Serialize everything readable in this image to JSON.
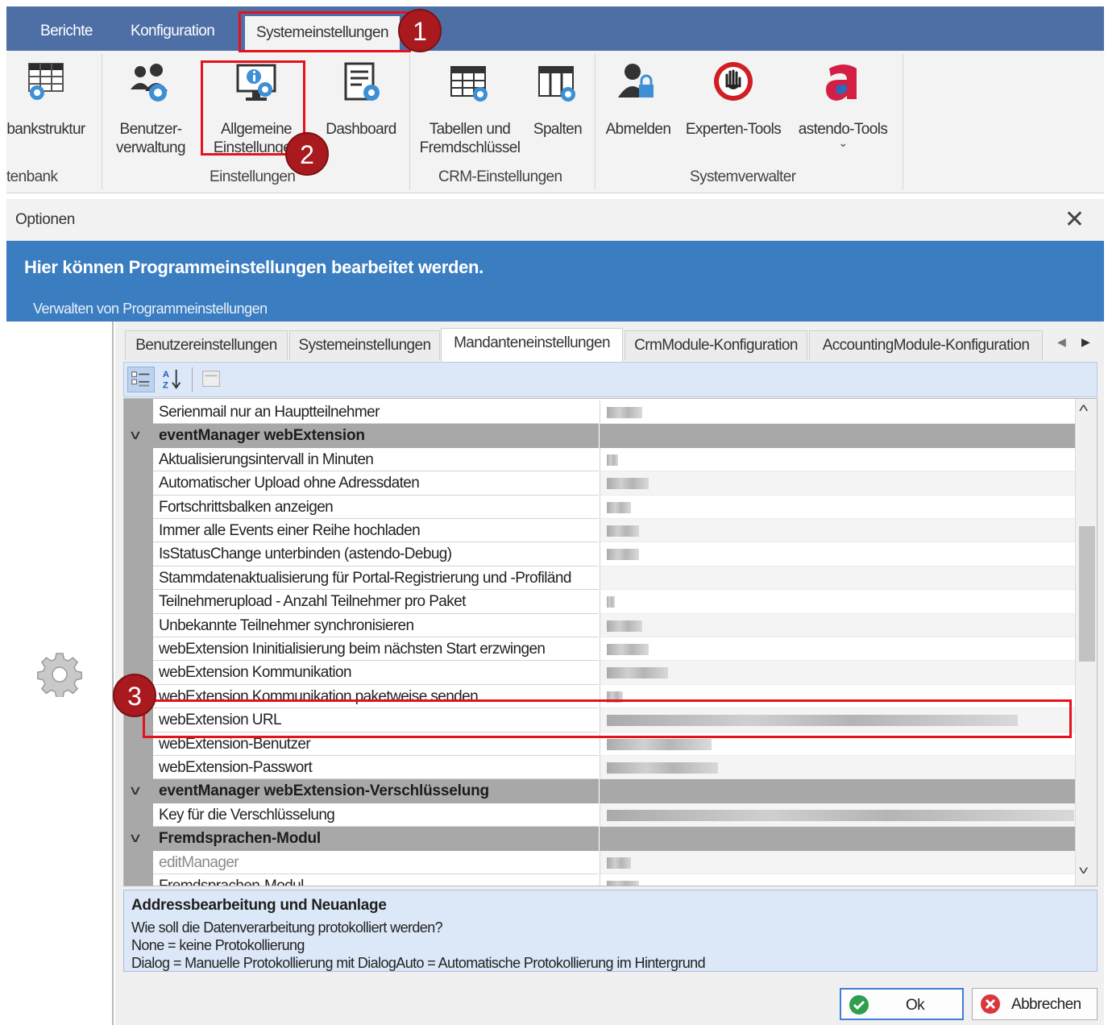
{
  "ribbon": {
    "tabs": [
      "Berichte",
      "Konfiguration",
      "Systemeinstellungen"
    ],
    "buttons": {
      "bankstruktur": "bankstruktur",
      "benutzer_line1": "Benutzer-",
      "benutzer_line2": "verwaltung",
      "allgemeine_line1": "Allgemeine",
      "allgemeine_line2": "Einstellungen",
      "dashboard": "Dashboard",
      "tabellen_line1": "Tabellen und",
      "tabellen_line2": "Fremdschlüssel",
      "spalten": "Spalten",
      "abmelden": "Abmelden",
      "experten": "Experten-Tools",
      "astendo": "astendo-Tools"
    },
    "groups": {
      "datenbank": "tenbank",
      "einstellungen": "Einstellungen",
      "crm": "CRM-Einstellungen",
      "systemverwalter": "Systemverwalter"
    }
  },
  "dialog": {
    "title": "Optionen",
    "close": "✕",
    "banner_heading": "Hier können Programmeinstellungen bearbeitet werden.",
    "banner_sub": "Verwalten von Programmeinstellungen",
    "tabs": [
      "Benutzereinstellungen",
      "Systemeinstellungen",
      "Mandanteneinstellungen",
      "CrmModule-Konfiguration",
      "AccountingModule-Konfiguration"
    ],
    "active_tab": "Mandanteneinstellungen",
    "rows": [
      {
        "type": "prop",
        "label": "Serienmail nur an Hauptteilnehmer"
      },
      {
        "type": "cat",
        "label": "eventManager webExtension"
      },
      {
        "type": "prop",
        "label": "Aktualisierungsintervall in Minuten"
      },
      {
        "type": "prop",
        "label": "Automatischer Upload ohne Adressdaten"
      },
      {
        "type": "prop",
        "label": "Fortschrittsbalken anzeigen"
      },
      {
        "type": "prop",
        "label": "Immer alle Events einer Reihe hochladen"
      },
      {
        "type": "prop",
        "label": "IsStatusChange unterbinden (astendo-Debug)"
      },
      {
        "type": "prop",
        "label": "Stammdatenaktualisierung für Portal-Registrierung und -Profiländ"
      },
      {
        "type": "prop",
        "label": "Teilnehmerupload - Anzahl Teilnehmer pro Paket"
      },
      {
        "type": "prop",
        "label": "Unbekannte Teilnehmer synchronisieren"
      },
      {
        "type": "prop",
        "label": "webExtension Ininitialisierung beim nächsten Start erzwingen"
      },
      {
        "type": "prop",
        "label": "webExtension Kommunikation"
      },
      {
        "type": "prop",
        "label": "webExtension Kommunikation paketweise senden"
      },
      {
        "type": "prop",
        "label": "webExtension URL"
      },
      {
        "type": "prop",
        "label": "webExtension-Benutzer"
      },
      {
        "type": "prop",
        "label": "webExtension-Passwort"
      },
      {
        "type": "cat",
        "label": "eventManager webExtension-Verschlüsselung"
      },
      {
        "type": "prop",
        "label": "Key für die Verschlüsselung"
      },
      {
        "type": "cat",
        "label": "Fremdsprachen-Modul"
      },
      {
        "type": "prop",
        "label": "editManager",
        "muted": true
      },
      {
        "type": "prop",
        "label": "Fremdsprachen-Modul"
      }
    ],
    "description": {
      "title": "Addressbearbeitung und Neuanlage",
      "lines": [
        "Wie soll die Datenverarbeitung protokolliert werden?",
        "None = keine Protokollierung",
        "Dialog = Manuelle Protokollierung mit DialogAuto = Automatische Protokollierung im Hintergrund"
      ]
    },
    "ok_label": "Ok",
    "cancel_label": "Abbrechen"
  },
  "annotations": [
    "1",
    "2",
    "3"
  ],
  "colors": {
    "ribbon_tab_bar": "#4d6fa6",
    "banner": "#3a7dc0",
    "annotation_red": "#e5121e",
    "annotation_badge": "#a81a1e"
  }
}
